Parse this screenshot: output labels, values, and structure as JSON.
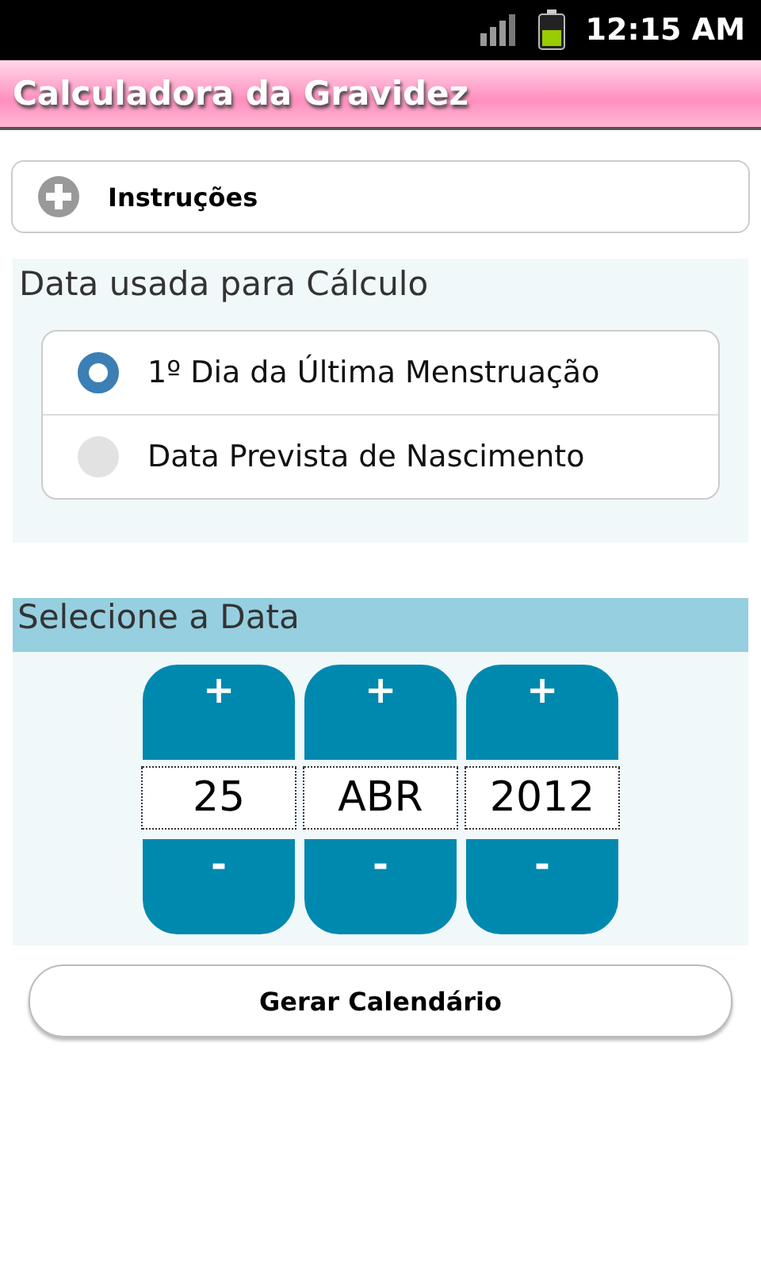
{
  "status_bar": {
    "time": "12:15 AM"
  },
  "title": "Calculadora da Gravidez",
  "instructions": {
    "label": "Instruções",
    "expanded": false
  },
  "calc_date": {
    "heading": "Data usada para Cálculo",
    "options": [
      {
        "label": "1º Dia da Última Menstruação",
        "selected": true
      },
      {
        "label": "Data Prevista de Nascimento",
        "selected": false
      }
    ]
  },
  "date_select": {
    "heading": "Selecione a Data",
    "fields": [
      {
        "increment": "+",
        "value": "25",
        "decrement": "-"
      },
      {
        "increment": "+",
        "value": "ABR",
        "decrement": "-"
      },
      {
        "increment": "+",
        "value": "2012",
        "decrement": "-"
      }
    ]
  },
  "generate_button": "Gerar Calendário"
}
